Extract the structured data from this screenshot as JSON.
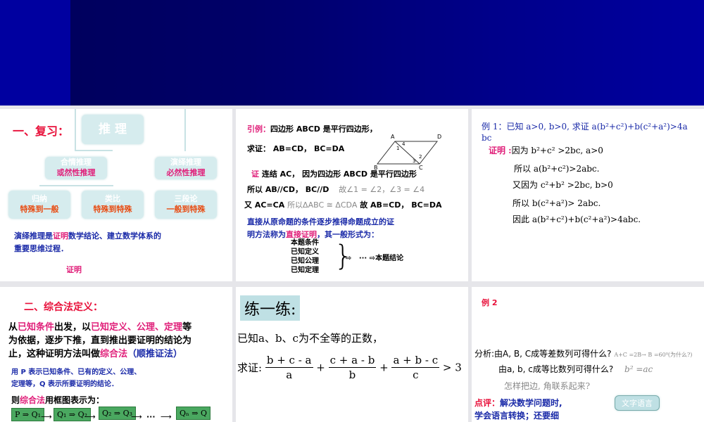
{
  "slide1": {
    "heading": "一、复习：",
    "root": "推 理",
    "node_a": "合情推理",
    "node_a_sub": "或然性推理",
    "node_b": "演绎推理",
    "node_b_sub": "必然性推理",
    "leaf1": "归纳",
    "leaf1_sub": "特殊到一般",
    "leaf2": "类比",
    "leaf2_sub": "特殊到特殊",
    "leaf3": "三段论",
    "leaf3_sub": "一般到特殊",
    "text_a": "演绎推理是",
    "text_hl": "证明",
    "text_b": "数学结论、建立数学体系的",
    "text_c": "重要思维过程．",
    "footer": "证明"
  },
  "slide2": {
    "label": "引例：",
    "line1": "四边形 ABCD 是平行四边形，",
    "line2": "求证： AB=CD， BC=DA",
    "proof_label": "证",
    "proof1": "连结 AC， 因为四边形 ABCD 是平行四边形",
    "proof2": "所以 AB//CD， BC//D",
    "proof2b": "故∠1 = ∠2，∠3 = ∠4",
    "proof3": "又 AC=CA",
    "proof3b": "所以ΔABC ≅ ΔCDA",
    "proof3c": "故 AB=CD， BC=DA",
    "desc1": "直接从原命题的条件逐步推得命题成立的证",
    "desc2a": "明方法称为",
    "desc2hl": "直接证明",
    "desc2b": "，其一般形式为：",
    "conds": [
      "本题条件",
      "已知定义",
      "已知公理",
      "已知定理"
    ],
    "dots": "···",
    "conclusion": "本题结论",
    "fig": {
      "A": "A",
      "B": "B",
      "C": "C",
      "D": "D",
      "n1": "1",
      "n2": "2",
      "n3": "3",
      "n4": "4"
    }
  },
  "slide3": {
    "line1a": "例 1：已知 a>0, b>0, 求证 a(b²+c²)+b(c²+a²)>4a",
    "line1b": "bc",
    "proof_label": "证明 :",
    "s1": "因为 b²+c² >2bc, a>0",
    "s2": "所以 a(b²+c²)>2abc.",
    "s3": "又因为 c²+b² >2bc, b>0",
    "s4": "所以 b(c²+a²)> 2abc.",
    "s5": "因此 a(b²+c²)+b(c²+a²)>4abc."
  },
  "slide4": {
    "heading": "二、综合法定义：",
    "p1": [
      "从",
      "已知条件",
      "出发，以",
      "已知定义、公理、定理",
      "等"
    ],
    "p2": "为依据，逐步下推，直到推出要证明的结论为",
    "p3": [
      "止，这种证明方法叫做",
      "综合法",
      "（顺推证法）"
    ],
    "n1": "用 P 表示已知条件、已有的定义、公理、",
    "n2": "定理等，Q 表示所要证明的结论．",
    "p4": [
      "则",
      "综合法",
      "用框图表示为："
    ],
    "boxes": [
      "P ⇒ Q₁",
      "Q₁ ⇒ Q₂",
      "Q₂ ⇒ Q₃",
      "Qₙ ⇒ Q"
    ],
    "dots": "···"
  },
  "slide5": {
    "title": "练一练:",
    "line1": "已知a、b、c为不全等的正数，",
    "prove": "求证:",
    "fracs": [
      {
        "n": "b + c - a",
        "d": "a"
      },
      {
        "n": "c + a - b",
        "d": "b"
      },
      {
        "n": "a + b - c",
        "d": "c"
      }
    ],
    "plus": "+",
    "tail": "> 3"
  },
  "slide6": {
    "title": "例 2",
    "a1": "分析:由A, B, C成等差数列可得什么?",
    "a1r": "A+C =2B→ B =60⁰(为什么?)",
    "a2": "由a, b, c成等比数列可得什么?",
    "a2r": "b² =ac",
    "a3": "怎样把边, 角联系起来?",
    "c_label": "点评：",
    "c1": "解决数学问题时,",
    "c2": "学会语言转换；还要细",
    "box": "文字语言"
  }
}
